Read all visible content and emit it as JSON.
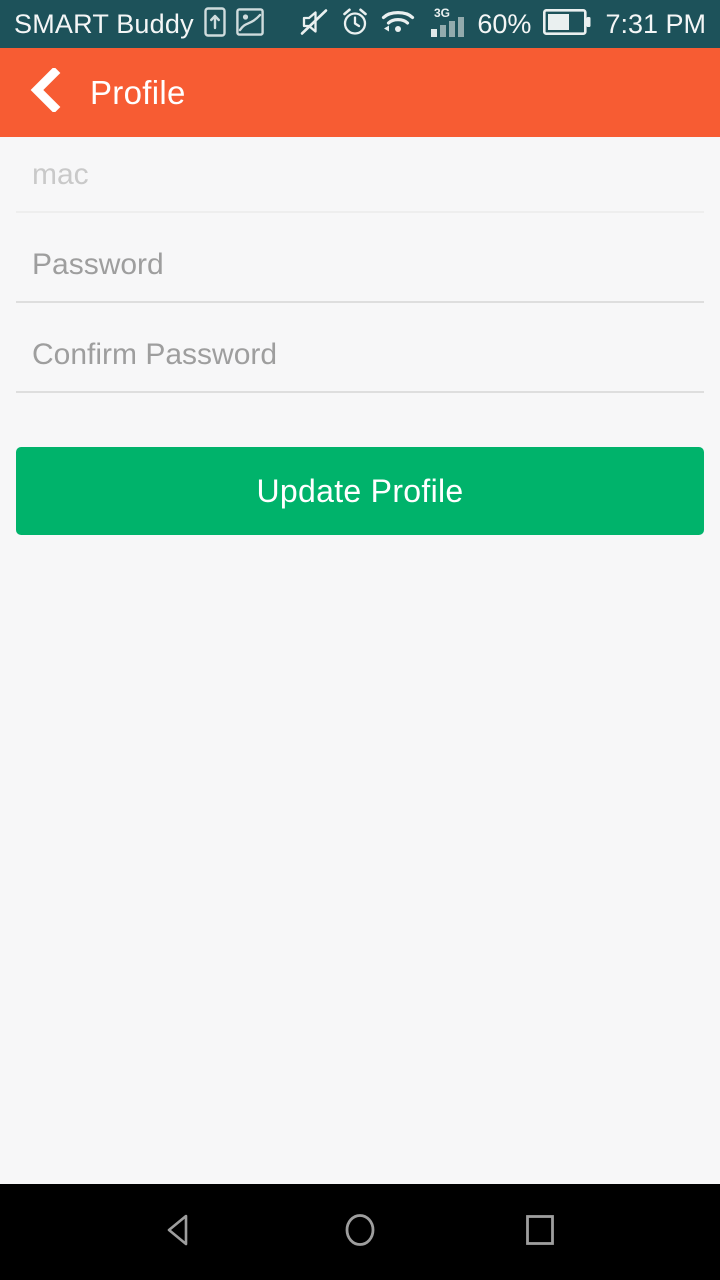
{
  "status_bar": {
    "carrier": "SMART Buddy",
    "battery_percent": "60%",
    "battery_level": 60,
    "time": "7:31 PM",
    "network_type": "3G",
    "signal_bars": 4,
    "signal_bars_active": 1,
    "background_color": "#1d525a",
    "text_color": "#f4f6f6",
    "icons": [
      "sim-card-icon",
      "screenshot-image-icon",
      "mute-icon",
      "alarm-clock-icon",
      "wifi-icon",
      "cellular-signal-icon",
      "battery-icon"
    ]
  },
  "app_bar": {
    "title": "Profile",
    "back_icon": "chevron-left-icon",
    "background_color": "#f75c33",
    "title_color": "#ffffff"
  },
  "form": {
    "fields": [
      {
        "name": "mac",
        "placeholder": "mac",
        "value": "",
        "type": "text",
        "faint": true
      },
      {
        "name": "password",
        "placeholder": "Password",
        "value": "",
        "type": "password",
        "faint": false
      },
      {
        "name": "confirm_password",
        "placeholder": "Confirm Password",
        "value": "",
        "type": "password",
        "faint": false
      }
    ],
    "submit_label": "Update Profile",
    "submit_color": "#00b36b",
    "submit_text_color": "#ffffff"
  },
  "nav_bar": {
    "background_color": "#000000",
    "buttons": [
      {
        "name": "back-nav-button",
        "icon": "triangle-back-icon"
      },
      {
        "name": "home-nav-button",
        "icon": "circle-home-icon"
      },
      {
        "name": "recents-nav-button",
        "icon": "square-recents-icon"
      }
    ]
  }
}
